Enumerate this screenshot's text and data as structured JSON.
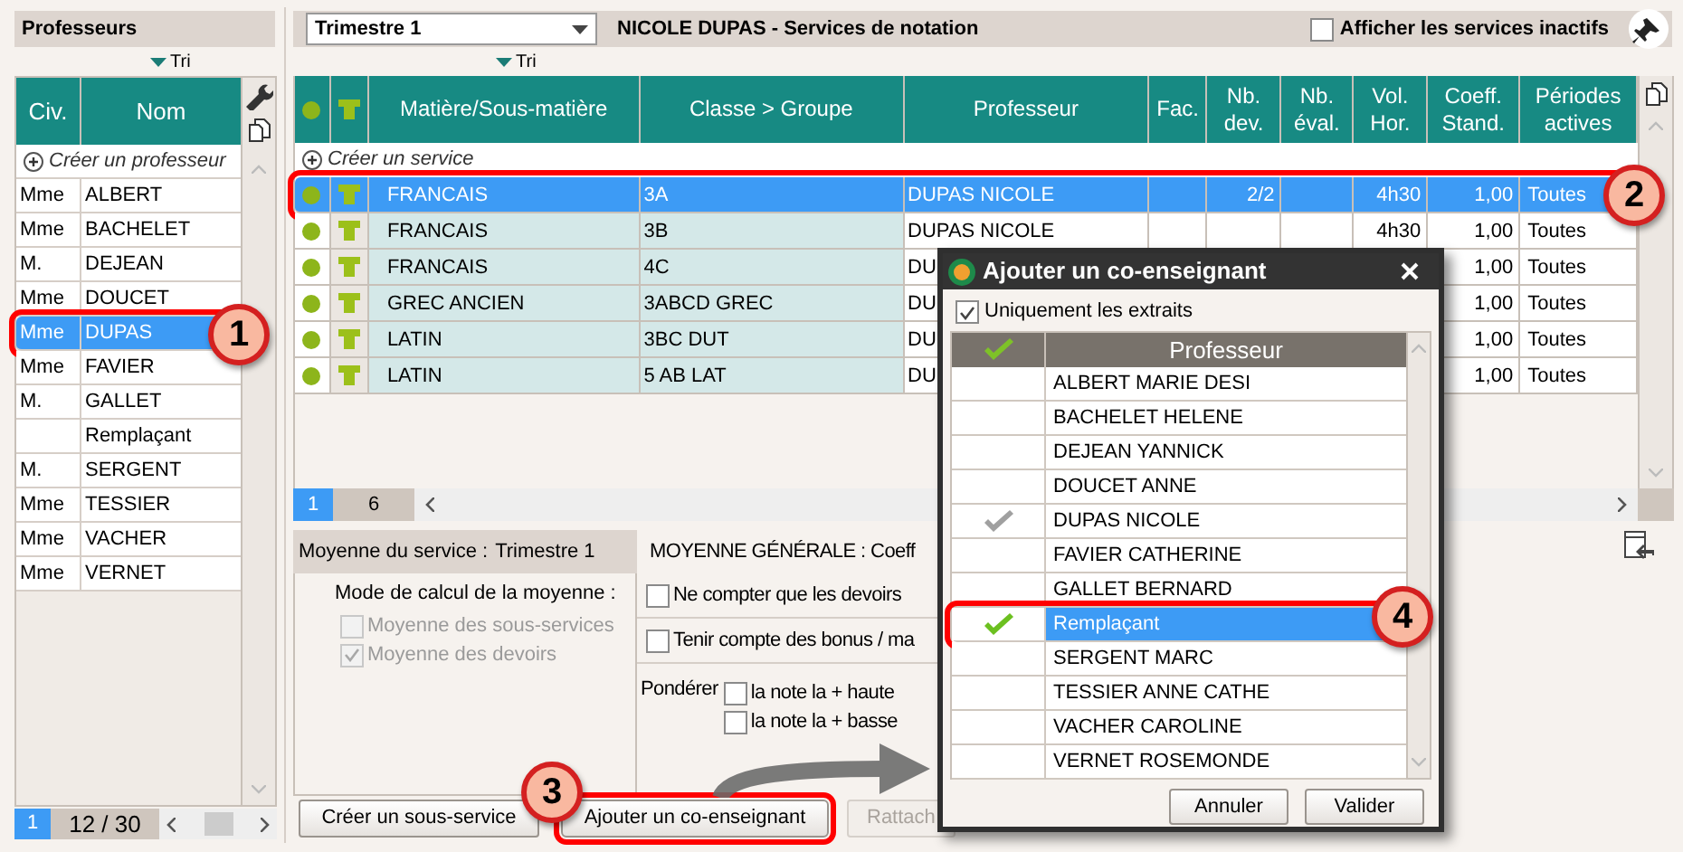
{
  "professors_panel": {
    "title": "Professeurs",
    "sort_label": "Tri",
    "columns": [
      "Civ.",
      "Nom"
    ],
    "create_label": "Créer un professeur",
    "rows": [
      {
        "civ": "Mme",
        "name": "ALBERT",
        "selected": false
      },
      {
        "civ": "Mme",
        "name": "BACHELET",
        "selected": false
      },
      {
        "civ": "M.",
        "name": "DEJEAN",
        "selected": false
      },
      {
        "civ": "Mme",
        "name": "DOUCET",
        "selected": false
      },
      {
        "civ": "Mme",
        "name": "DUPAS",
        "selected": true
      },
      {
        "civ": "Mme",
        "name": "FAVIER",
        "selected": false
      },
      {
        "civ": "M.",
        "name": "GALLET",
        "selected": false
      },
      {
        "civ": "",
        "name": "Remplaçant",
        "selected": false
      },
      {
        "civ": "M.",
        "name": "SERGENT",
        "selected": false
      },
      {
        "civ": "Mme",
        "name": "TESSIER",
        "selected": false
      },
      {
        "civ": "Mme",
        "name": "VACHER",
        "selected": false
      },
      {
        "civ": "Mme",
        "name": "VERNET",
        "selected": false
      }
    ],
    "pagination": {
      "page": "1",
      "count": "12 / 30"
    }
  },
  "services_panel": {
    "period": "Trimestre 1",
    "title": "NICOLE DUPAS - Services de notation",
    "show_inactive": {
      "label": "Afficher les services inactifs",
      "checked": false
    },
    "sort_label": "Tri",
    "columns": [
      "Matière/Sous-matière",
      "Classe > Groupe",
      "Professeur",
      "Fac.",
      "Nb. dev.",
      "Nb. éval.",
      "Vol. Hor.",
      "Coeff. Stand.",
      "Périodes actives"
    ],
    "create_label": "Créer un service",
    "rows": [
      {
        "cells": [
          "FRANCAIS",
          "3A",
          "DUPAS NICOLE",
          "",
          "2/2",
          "",
          "4h30",
          "1,00",
          "Toutes"
        ],
        "selected": true
      },
      {
        "cells": [
          "FRANCAIS",
          "3B",
          "DUPAS NICOLE",
          "",
          "",
          "",
          "4h30",
          "1,00",
          "Toutes"
        ],
        "selected": false
      },
      {
        "cells": [
          "FRANCAIS",
          "4C",
          "DU",
          "",
          "",
          "",
          "",
          "1,00",
          "Toutes"
        ],
        "selected": false
      },
      {
        "cells": [
          "GREC ANCIEN",
          "3ABCD GREC",
          "DU",
          "",
          "",
          "",
          "",
          "1,00",
          "Toutes"
        ],
        "selected": false
      },
      {
        "cells": [
          "LATIN",
          "3BC DUT",
          "DU",
          "",
          "",
          "",
          "",
          "1,00",
          "Toutes"
        ],
        "selected": false
      },
      {
        "cells": [
          "LATIN",
          "5 AB LAT",
          "DU",
          "",
          "",
          "",
          "",
          "1,00",
          "Toutes"
        ],
        "selected": false
      }
    ],
    "tabs": [
      {
        "label": "1",
        "selected": true
      },
      {
        "label": "6",
        "selected": false
      }
    ]
  },
  "service_average": {
    "header_label": "Moyenne du service :",
    "period": "Trimestre 1",
    "mode_label": "Mode de calcul de la moyenne :",
    "options": [
      {
        "label": "Moyenne des sous-services",
        "checked": false,
        "disabled": true
      },
      {
        "label": "Moyenne des devoirs",
        "checked": true,
        "disabled": true
      }
    ]
  },
  "general_average": {
    "header": "MOYENNE GÉNÉRALE : Coeff",
    "options": [
      {
        "label": "Ne compter que les devoirs",
        "checked": false
      },
      {
        "label": "Tenir compte des bonus / ma",
        "checked": false
      }
    ],
    "weighting": {
      "label": "Pondérer",
      "options": [
        {
          "label": "la note la + haute",
          "checked": false
        },
        {
          "label": "la note la + basse",
          "checked": false
        }
      ]
    }
  },
  "buttons": [
    {
      "label": "Créer un sous-service",
      "disabled": false
    },
    {
      "label": "Ajouter un co-enseignant",
      "disabled": false
    },
    {
      "label": "Rattach",
      "disabled": true
    }
  ],
  "dialog": {
    "title": "Ajouter un co-enseignant",
    "filter": {
      "label": "Uniquement les extraits",
      "checked": true
    },
    "column": "Professeur",
    "rows": [
      {
        "name": "ALBERT MARIE DESI",
        "checked": false,
        "selected": false
      },
      {
        "name": "BACHELET HELENE",
        "checked": false,
        "selected": false
      },
      {
        "name": "DEJEAN YANNICK",
        "checked": false,
        "selected": false
      },
      {
        "name": "DOUCET ANNE",
        "checked": false,
        "selected": false
      },
      {
        "name": "DUPAS NICOLE",
        "checked": true,
        "disabled": true,
        "selected": false
      },
      {
        "name": "FAVIER CATHERINE",
        "checked": false,
        "selected": false
      },
      {
        "name": "GALLET BERNARD",
        "checked": false,
        "selected": false
      },
      {
        "name": "Remplaçant",
        "checked": true,
        "disabled": false,
        "selected": true
      },
      {
        "name": "SERGENT MARC",
        "checked": false,
        "selected": false
      },
      {
        "name": "TESSIER ANNE CATHE",
        "checked": false,
        "selected": false
      },
      {
        "name": "VACHER CAROLINE",
        "checked": false,
        "selected": false
      },
      {
        "name": "VERNET ROSEMONDE",
        "checked": false,
        "selected": false
      }
    ],
    "buttons": [
      "Annuler",
      "Valider"
    ]
  },
  "callouts": [
    {
      "label": "1"
    },
    {
      "label": "2"
    },
    {
      "label": "3"
    },
    {
      "label": "4"
    }
  ]
}
